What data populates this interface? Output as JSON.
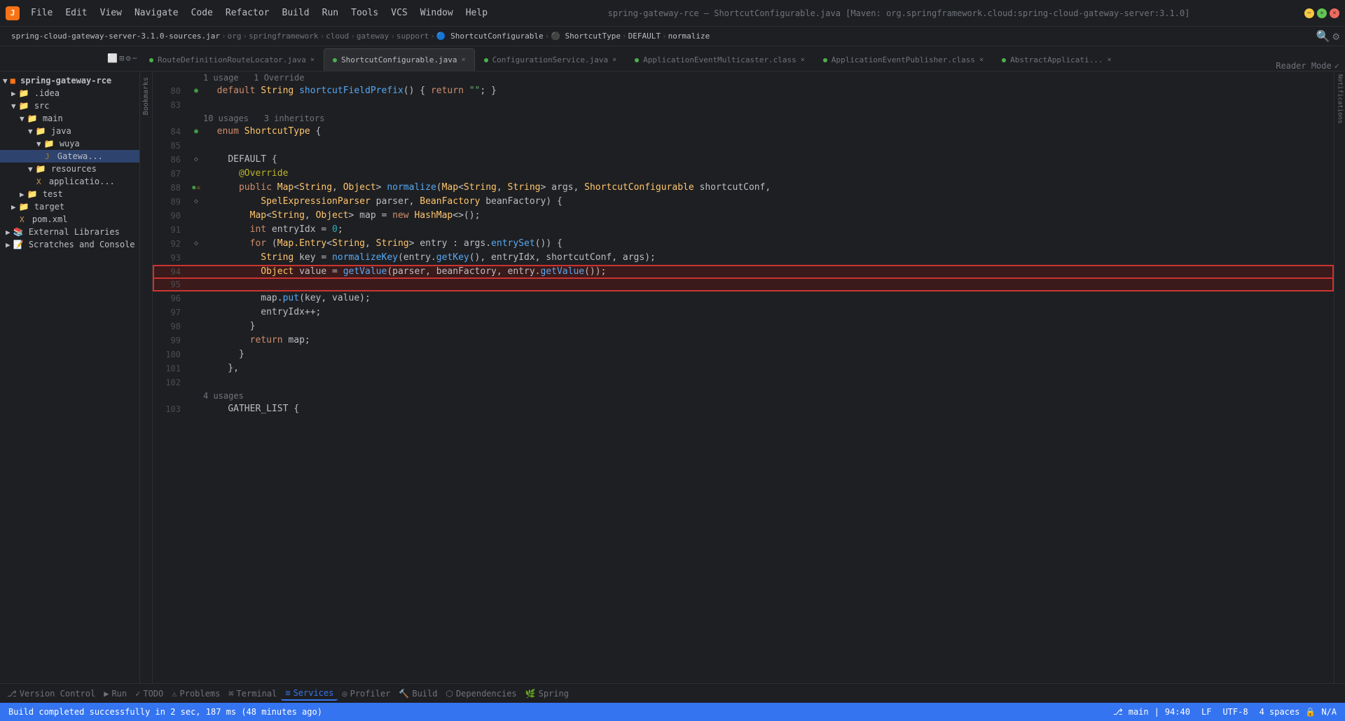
{
  "window": {
    "title": "spring-gateway-rce – ShortcutConfigurable.java [Maven: org.springframework.cloud:spring-cloud-gateway-server:3.1.0]",
    "app_name": "IntelliJ IDEA"
  },
  "menu": {
    "items": [
      "File",
      "Edit",
      "View",
      "Navigate",
      "Code",
      "Refactor",
      "Build",
      "Run",
      "Tools",
      "VCS",
      "Window",
      "Help"
    ]
  },
  "breadcrumb": {
    "items": [
      "spring-cloud-gateway-server-3.1.0-sources.jar",
      "org",
      "springframework",
      "cloud",
      "gateway",
      "support",
      "ShortcutConfigurable",
      "ShortcutType",
      "DEFAULT",
      "normalize"
    ]
  },
  "tabs": [
    {
      "label": "RouteDefinitionRouteLocator.java",
      "active": false,
      "dot_color": "#4caf50"
    },
    {
      "label": "ShortcutConfigurable.java",
      "active": true,
      "dot_color": "#4caf50"
    },
    {
      "label": "ConfigurationService.java",
      "active": false,
      "dot_color": "#4caf50"
    },
    {
      "label": "ApplicationEventMulticaster.class",
      "active": false,
      "dot_color": "#4caf50"
    },
    {
      "label": "ApplicationEventPublisher.class",
      "active": false,
      "dot_color": "#4caf50"
    },
    {
      "label": "AbstractApplicati...",
      "active": false,
      "dot_color": "#4caf50"
    }
  ],
  "sidebar": {
    "items": [
      {
        "label": "spring-gateway-rce",
        "level": 0,
        "type": "project",
        "expanded": true
      },
      {
        "label": ".idea",
        "level": 1,
        "type": "folder",
        "expanded": false
      },
      {
        "label": "src",
        "level": 1,
        "type": "folder",
        "expanded": true
      },
      {
        "label": "main",
        "level": 2,
        "type": "folder",
        "expanded": true
      },
      {
        "label": "java",
        "level": 3,
        "type": "folder",
        "expanded": true
      },
      {
        "label": "wuya",
        "level": 4,
        "type": "folder",
        "expanded": true
      },
      {
        "label": "Gatewa...",
        "level": 5,
        "type": "java",
        "expanded": false
      },
      {
        "label": "resources",
        "level": 3,
        "type": "folder",
        "expanded": false
      },
      {
        "label": "applicatio...",
        "level": 4,
        "type": "xml",
        "expanded": false
      },
      {
        "label": "test",
        "level": 2,
        "type": "folder",
        "expanded": false
      },
      {
        "label": "target",
        "level": 1,
        "type": "folder",
        "expanded": false
      },
      {
        "label": "pom.xml",
        "level": 2,
        "type": "xml",
        "expanded": false
      },
      {
        "label": "External Libraries",
        "level": 0,
        "type": "library",
        "expanded": false
      },
      {
        "label": "Scratches and Console",
        "level": 0,
        "type": "scratches",
        "expanded": false
      }
    ]
  },
  "code": {
    "header": "1 usage  1 Override",
    "usages_line1": "10 usages   3 inheritors",
    "lines": [
      {
        "num": "80",
        "code": "  default String shortcutFieldPrefix() { return \"\"; }",
        "gutter": "◉"
      },
      {
        "num": "83",
        "code": "",
        "gutter": ""
      },
      {
        "num": "",
        "code": "10 usages   3 inheritors",
        "gutter": "",
        "is_meta": true
      },
      {
        "num": "84",
        "code": "  enum ShortcutType {",
        "gutter": "◉"
      },
      {
        "num": "85",
        "code": "",
        "gutter": ""
      },
      {
        "num": "86",
        "code": "    DEFAULT {",
        "gutter": "◇"
      },
      {
        "num": "87",
        "code": "      @Override",
        "gutter": ""
      },
      {
        "num": "88",
        "code": "      public Map<String, Object> normalize(Map<String, String> args, ShortcutConfigurable shortcutConf,",
        "gutter": "◉⚠"
      },
      {
        "num": "89",
        "code": "          SpelExpressionParser parser, BeanFactory beanFactory) {",
        "gutter": "◇"
      },
      {
        "num": "90",
        "code": "        Map<String, Object> map = new HashMap<>();",
        "gutter": ""
      },
      {
        "num": "91",
        "code": "        int entryIdx = 0;",
        "gutter": ""
      },
      {
        "num": "92",
        "code": "        for (Map.Entry<String, String> entry : args.entrySet()) {",
        "gutter": "◇"
      },
      {
        "num": "93",
        "code": "          String key = normalizeKey(entry.getKey(), entryIdx, shortcutConf, args);",
        "gutter": ""
      },
      {
        "num": "94",
        "code": "          Object value = getValue(parser, beanFactory, entry.getValue());",
        "gutter": "",
        "highlighted": true
      },
      {
        "num": "95",
        "code": "",
        "gutter": "",
        "highlighted_empty": true
      },
      {
        "num": "96",
        "code": "          map.put(key, value);",
        "gutter": ""
      },
      {
        "num": "97",
        "code": "          entryIdx++;",
        "gutter": ""
      },
      {
        "num": "98",
        "code": "        }",
        "gutter": ""
      },
      {
        "num": "99",
        "code": "        return map;",
        "gutter": ""
      },
      {
        "num": "100",
        "code": "      }",
        "gutter": ""
      },
      {
        "num": "101",
        "code": "    },",
        "gutter": ""
      },
      {
        "num": "102",
        "code": "",
        "gutter": ""
      },
      {
        "num": "",
        "code": "4 usages",
        "gutter": "",
        "is_meta": true
      },
      {
        "num": "103",
        "code": "    GATHER_LIST {",
        "gutter": ""
      }
    ]
  },
  "bottom_tabs": [
    {
      "label": "Version Control",
      "icon": "⎇"
    },
    {
      "label": "Run",
      "icon": "▶"
    },
    {
      "label": "TODO",
      "icon": "✓"
    },
    {
      "label": "Problems",
      "icon": "⚠"
    },
    {
      "label": "Terminal",
      "icon": ">"
    },
    {
      "label": "Services",
      "icon": "≡",
      "active": true
    },
    {
      "label": "Profiler",
      "icon": "◎"
    },
    {
      "label": "Build",
      "icon": "🔨"
    },
    {
      "label": "Dependencies",
      "icon": "⬡"
    },
    {
      "label": "Spring",
      "icon": "🌿"
    }
  ],
  "status_bar": {
    "message": "Build completed successfully in 2 sec, 187 ms (48 minutes ago)",
    "position": "94:40",
    "encoding": "LF",
    "charset": "UTF-8",
    "indent": "4 spaces",
    "branch": "⎇",
    "readonly": "🔒",
    "na": "N/A"
  },
  "reader_mode": "Reader Mode"
}
